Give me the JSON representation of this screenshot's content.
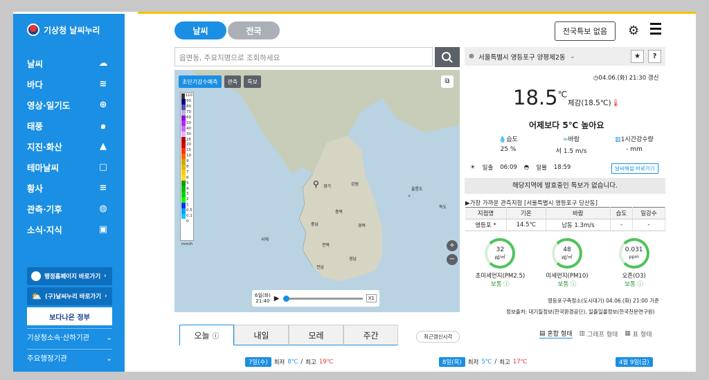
{
  "sidebar": {
    "logo": "기상청 날씨누리",
    "items": [
      {
        "label": "날씨"
      },
      {
        "label": "바다"
      },
      {
        "label": "영상·일기도"
      },
      {
        "label": "태풍"
      },
      {
        "label": "지진·화산"
      },
      {
        "label": "테마날씨"
      },
      {
        "label": "황사"
      },
      {
        "label": "관측·기후"
      },
      {
        "label": "소식·지식"
      }
    ],
    "link_gov": "행정홈페이지 바로가기",
    "link_weather": "(구)날씨누리 바로가기",
    "banner": "보다나은 정부",
    "link_affiliated": "기상청소속·산하기관",
    "link_major": "주요행정기관"
  },
  "header": {
    "tab_weather": "날씨",
    "tab_national": "전국",
    "special_button": "전국특보 없음"
  },
  "search": {
    "placeholder": "읍면동, 주요지명으로 조회하세요"
  },
  "map": {
    "tabs": [
      "초단기강수예측",
      "관측",
      "특보"
    ],
    "legend": [
      {
        "v": "110",
        "c": "#333333"
      },
      {
        "v": "90",
        "c": "#000090"
      },
      {
        "v": "80",
        "c": "#4c4eb1"
      },
      {
        "v": "70",
        "c": "#b3b4de"
      },
      {
        "v": "60",
        "c": "#9300e4"
      },
      {
        "v": "50",
        "c": "#b329ff"
      },
      {
        "v": "40",
        "c": "#c969ff"
      },
      {
        "v": "30",
        "c": "#e0b4ff"
      },
      {
        "v": "25",
        "c": "#b40000"
      },
      {
        "v": "20",
        "c": "#d20000"
      },
      {
        "v": "15",
        "c": "#ff3300"
      },
      {
        "v": "10",
        "c": "#ff6600"
      },
      {
        "v": "9",
        "c": "#ccaa00"
      },
      {
        "v": "8",
        "c": "#e0b900"
      },
      {
        "v": "7",
        "c": "#f9cd00"
      },
      {
        "v": "6",
        "c": "#ffdc1f"
      },
      {
        "v": "5",
        "c": "#00a000"
      },
      {
        "v": "4",
        "c": "#00be00"
      },
      {
        "v": "3",
        "c": "#00d500"
      },
      {
        "v": "2",
        "c": "#00ff00"
      },
      {
        "v": "1",
        "c": "#0033ff"
      },
      {
        "v": "0.5",
        "c": "#009bf5"
      },
      {
        "v": "0.1",
        "c": "#00c8ff"
      },
      {
        "v": "0",
        "c": "#ffffff"
      }
    ],
    "legend_unit": "mm/h",
    "labels": {
      "seoul": "서울",
      "gyeonggi": "경기",
      "gangwon": "강원",
      "chungbuk": "충북",
      "chungnam": "충남",
      "gyeongbuk": "경북",
      "jeonbuk": "전북",
      "gyeongnam": "경남",
      "jeonnam": "전남",
      "jeju": "제주",
      "ulleung": "울릉도",
      "dokdo": "독도",
      "yellowsea": "서해"
    },
    "play_time": "6일(화)\n21:40",
    "speed": "X1"
  },
  "location": {
    "name": "서울특별시 영등포구 양평제2동"
  },
  "current": {
    "updated": "04.06.(화) 21:30 갱신",
    "temp": "18.5",
    "temp_unit": "℃",
    "feel": "체감(18.5℃)",
    "compare": "어제보다 5℃ 높아요",
    "humidity_label": "습도",
    "humidity": "25 %",
    "wind_label": "바람",
    "wind": "서 1.5 m/s",
    "rain_label": "1시간강수량",
    "rain": "- mm",
    "sunrise_label": "일출",
    "sunrise": "06:09",
    "sunset_label": "일몰",
    "sunset": "18:59",
    "explain_button": "날씨해설 바로가기",
    "notice": "해당지역에 발효중인 특보가 없습니다."
  },
  "nearby": {
    "title": "가장 가까운 관측지점 [서울특별시 영등포구 당산동]",
    "headers": [
      "지점명",
      "기온",
      "바람",
      "습도",
      "일강수"
    ],
    "row": [
      "영등포 *",
      "14.5℃",
      "남동 1.3m/s",
      "-",
      "-"
    ]
  },
  "air": [
    {
      "value": "32",
      "unit": "㎍/㎥",
      "name": "초미세먼지(PM2.5)",
      "grade": "보통"
    },
    {
      "value": "48",
      "unit": "㎍/㎥",
      "name": "미세먼지(PM10)",
      "grade": "보통"
    },
    {
      "value": "0.031",
      "unit": "ppm",
      "name": "오존(O3)",
      "grade": "보통"
    }
  ],
  "air_source": "영등포구측정소(도시대기) 04.06.(화) 21:00 기준",
  "info_source": "정보출처: 대기질정보(한국환경공단), 일출일몰정보(한국천문연구원)",
  "forecast": {
    "tabs": [
      "오늘",
      "내일",
      "모레",
      "주간"
    ],
    "recent_button": "최근갱신시각",
    "views": [
      "혼합 형태",
      "그래프 형태",
      "표 형태"
    ],
    "days": [
      {
        "date": "7일(수)",
        "min_label": "최저",
        "min": "8℃",
        "max_label": "최고",
        "max": "19℃"
      },
      {
        "date": "8일(목)",
        "min_label": "최저",
        "min": "5℃",
        "max_label": "최고",
        "max": "17℃"
      },
      {
        "date": "4월 9일(금)"
      }
    ]
  }
}
